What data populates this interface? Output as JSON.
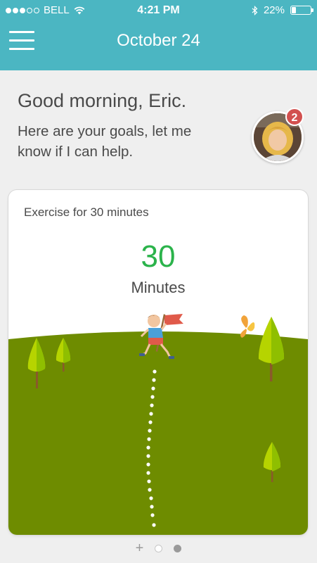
{
  "status_bar": {
    "carrier": "BELL",
    "time": "4:21 PM",
    "battery": "22%"
  },
  "header": {
    "title": "October 24",
    "menu_icon": "hamburger-menu-icon"
  },
  "greeting": {
    "headline": "Good morning, Eric.",
    "message": "Here are your goals, let me know if I can help."
  },
  "coach": {
    "notification_count": "2"
  },
  "goal_card": {
    "goal_label": "Exercise for 30 minutes",
    "value": "30",
    "unit": "Minutes"
  },
  "pager": {
    "add_symbol": "+",
    "pages": 2,
    "active_page": 1
  },
  "colors": {
    "header_bg": "#4bb6c2",
    "accent_green": "#2bb34b",
    "hill_green": "#6e8c00",
    "badge_red": "#d2504f"
  }
}
